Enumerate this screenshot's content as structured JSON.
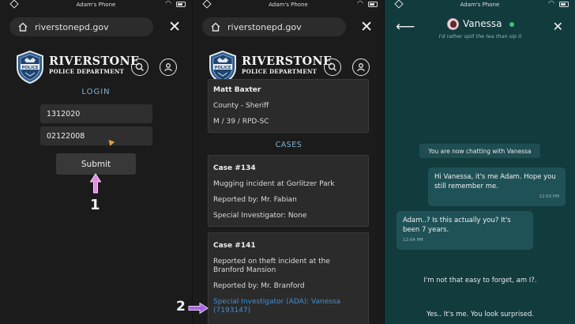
{
  "status": {
    "device_name": "Adam's Phone"
  },
  "browser": {
    "url": "riverstonepd.gov"
  },
  "brand": {
    "name": "RIVERSTONE",
    "subtitle": "POLICE DEPARTMENT",
    "badge_text": "POLICE"
  },
  "login": {
    "title": "LOGIN",
    "username": "1312020",
    "password": "02122008",
    "submit_label": "Submit",
    "step_label": "1"
  },
  "profile": {
    "name": "Matt Baxter",
    "county": "County - Sheriff",
    "details": "M / 39 / RPD-SC"
  },
  "cases": {
    "title": "CASES",
    "items": [
      {
        "id": "Case #134",
        "description": "Mugging incident at Gorlitzer Park",
        "reported_by": "Reported by: Mr. Fabian",
        "investigator": "Special Investigator: None"
      },
      {
        "id": "Case #141",
        "description_line1": "Reported on theft incident at the",
        "description_line2": "Branford Mansion",
        "reported_by": "Reported by: Mr. Branford",
        "investigator_line1": "Special Investigator (ADA): Vanessa",
        "investigator_line2": "(7193147)"
      }
    ],
    "step_label": "2"
  },
  "chat": {
    "contact_name": "Vanessa",
    "contact_status": "I'd rather spill the tea than sip it",
    "system_message": "You are now chatting with Vanessa",
    "messages": [
      {
        "text": "Hi Vanessa, it's me Adam. Hope you still remember me.",
        "time": "12:03 PM",
        "from": "me"
      },
      {
        "text": "Adam..? Is this actually you? It's been 7 years.",
        "time": "12:04 PM",
        "from": "them"
      }
    ],
    "lines": [
      "I'm not that easy to forget, am I?.",
      "Yes.. It's me. You look surprised."
    ],
    "colors": {
      "online": "#3fc36d",
      "bubble": "#1f5257",
      "background": "#123b3e"
    }
  }
}
